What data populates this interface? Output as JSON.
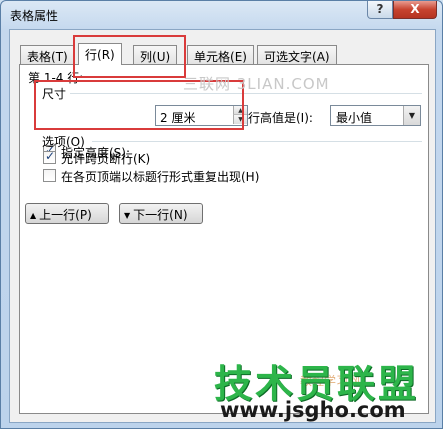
{
  "window": {
    "title": "表格属性",
    "help_label": "?",
    "close_label": "X"
  },
  "tabs": [
    {
      "label": "表格",
      "key": "(T)"
    },
    {
      "label": "行",
      "key": "(R)"
    },
    {
      "label": "列",
      "key": "(U)"
    },
    {
      "label": "单元格",
      "key": "(E)"
    },
    {
      "label": "可选文字",
      "key": "(A)"
    }
  ],
  "row_tab": {
    "rows_label": "第 1-4 行:",
    "size": {
      "section_label": "尺寸",
      "specify_height_label": "指定高度(S):",
      "specify_height_checked": true,
      "height_value": "2 厘米",
      "row_height_is_label": "行高值是(I):",
      "row_height_is_value": "最小值"
    },
    "options": {
      "section_label": "选项(O)",
      "allow_break_label": "允许跨页断行(K)",
      "allow_break_checked": true,
      "repeat_header_label": "在各页顶端以标题行形式重复出现(H)",
      "repeat_header_checked": false
    },
    "prev_row_label": "上一行(P)",
    "next_row_label": "下一行(N)"
  },
  "watermarks": {
    "top": "三联网 3LIAN.COM",
    "logo": "技术员联盟",
    "url": "www.jsgho.com",
    "faint": "教程学习网"
  },
  "colors": {
    "highlight_box": "#d93b3b",
    "logo_green": "#2db54a"
  }
}
